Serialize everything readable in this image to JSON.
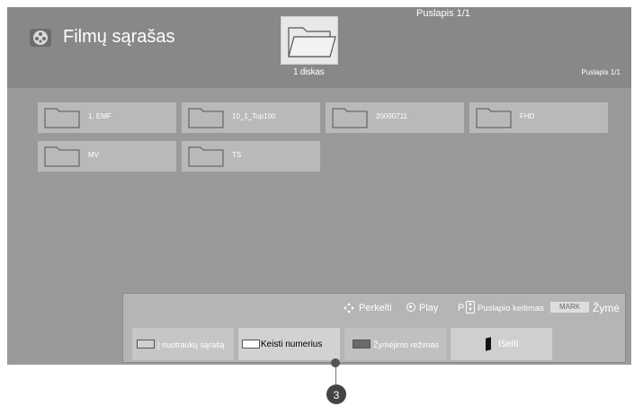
{
  "header": {
    "title": "Filmų sąrašas",
    "page_indicator_top": "Puslapis 1/1",
    "page_indicator_right": "Puslapis 1/1",
    "disk_label": "1 diskas",
    "app_icon": "film-reel-icon"
  },
  "folders": [
    {
      "name": "1. EMF"
    },
    {
      "name": "10_1_Top100"
    },
    {
      "name": "20090711"
    },
    {
      "name": "FHD"
    },
    {
      "name": "MV"
    },
    {
      "name": "TS"
    }
  ],
  "footer": {
    "hints": {
      "move": "Perkelti",
      "play": "Play",
      "p_key": "P",
      "page_change": "Puslapio keitimas",
      "mark_badge": "MARK",
      "mark": "Žymė"
    },
    "buttons": {
      "download": "Į nuotraukų sąrašą",
      "renumber": "Keisti numerius",
      "select_mode": "Žymėjimo režimas",
      "exit": "Išeiti"
    }
  },
  "callout": {
    "number": "3"
  },
  "colors": {
    "background": "#9a9a9a",
    "header": "#888888",
    "tile": "#b9b9b9",
    "footer": "#b5b5b5"
  }
}
